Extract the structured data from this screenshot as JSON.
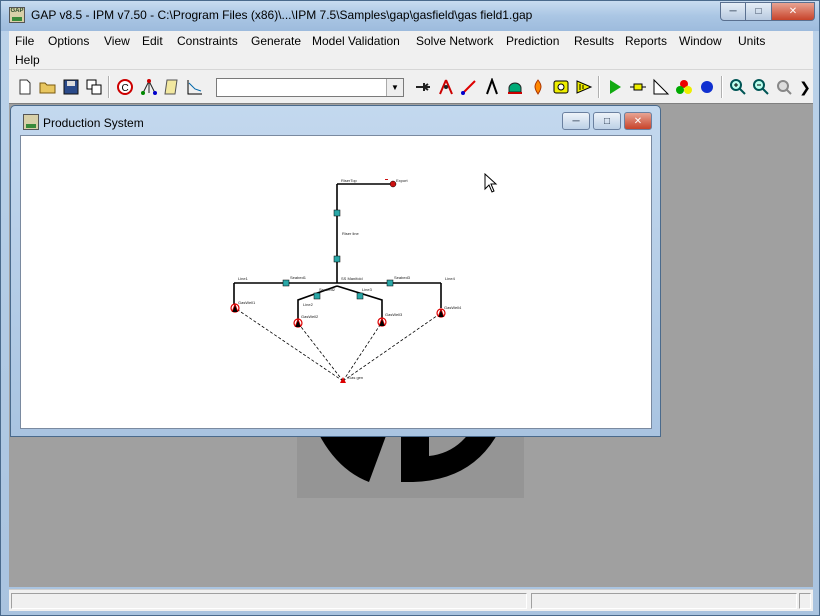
{
  "window": {
    "title": "GAP v8.5 - IPM v7.50 - C:\\Program Files (x86)\\...\\IPM 7.5\\Samples\\gap\\gasfield\\gas field1.gap",
    "app_icon_text": "GAP"
  },
  "menu": [
    "File",
    "Options",
    "View",
    "Edit",
    "Constraints",
    "Generate",
    "Model Validation",
    "Solve Network",
    "Prediction",
    "Results",
    "Reports",
    "Window",
    "Units",
    "Help"
  ],
  "toolbar": {
    "combo_value": "",
    "icons": [
      "new-file-icon",
      "open-folder-icon",
      "save-icon",
      "copy-windows-icon",
      "copyright-icon",
      "network-tree-icon",
      "script-icon",
      "graph-icon",
      "equipment-icon",
      "pipe-icon",
      "line-icon",
      "separator-icon",
      "tank-icon",
      "flame-icon",
      "well-icon",
      "joint-icon",
      "run-icon",
      "node-icon",
      "ramp-icon",
      "colors-icon",
      "blue-dot-icon",
      "zoom-in-icon",
      "zoom-out-icon",
      "zoom-fit-icon",
      "more-icon"
    ]
  },
  "child_window": {
    "title": "Production System"
  },
  "network": {
    "labels": {
      "top_pipe": "RiserTop",
      "sink": "Export",
      "riser": "Riser line",
      "manifold": "SS Manifold",
      "line1": "Line1",
      "line2": "Line2",
      "line3": "Line3",
      "line4": "Line4",
      "seabed1": "Seabed1",
      "seabed2": "Seabed2",
      "seabed3": "Seabed3",
      "well1": "GasWell1",
      "well2": "GasWell2",
      "well3": "GasWell3",
      "well4": "GasWell4",
      "source": "Gas gen"
    }
  },
  "status": [
    "",
    "",
    ""
  ]
}
